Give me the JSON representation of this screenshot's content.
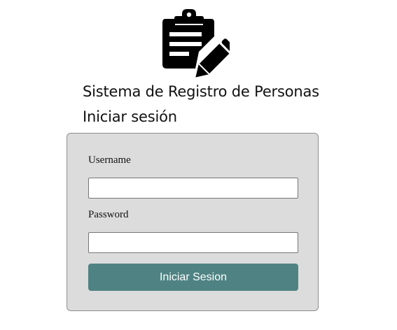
{
  "header": {
    "logo_icon": "clipboard-pencil-icon",
    "app_title": "Sistema de Registro de Personas",
    "subtitle": "Iniciar sesión"
  },
  "login_form": {
    "username_label": "Username",
    "username_value": "",
    "password_label": "Password",
    "password_value": "",
    "submit_label": "Iniciar Sesion"
  },
  "colors": {
    "card_background": "#dcdcdc",
    "card_border": "#8e8e8e",
    "button_background": "#4f8383",
    "button_text": "#ffffff",
    "icon": "#000000"
  }
}
